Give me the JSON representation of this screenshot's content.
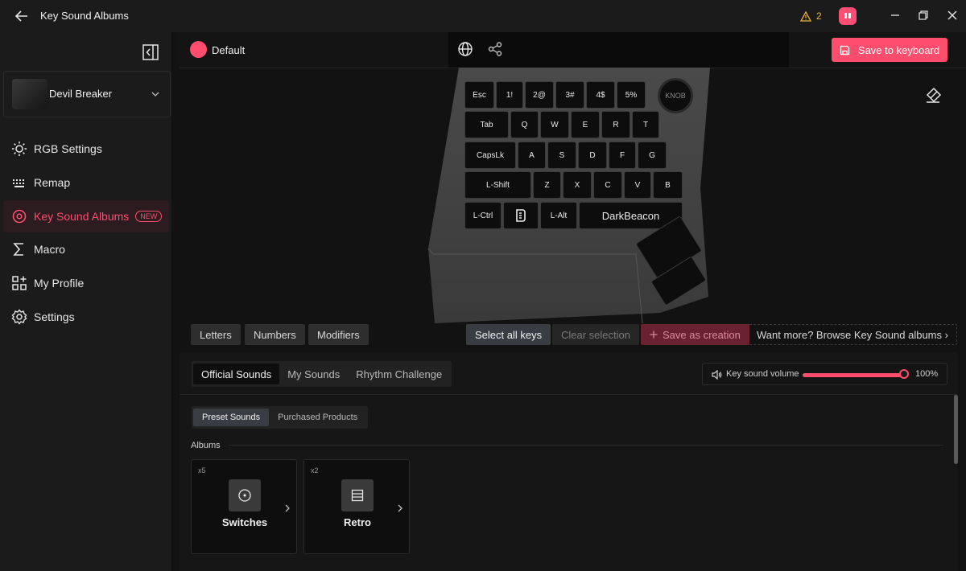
{
  "window": {
    "title": "Key Sound Albums",
    "warning_count": "2"
  },
  "sidebar": {
    "device_name": "Devil Breaker",
    "items": [
      {
        "label": "RGB Settings",
        "icon": "sun-icon"
      },
      {
        "label": "Remap",
        "icon": "keyboard-icon"
      },
      {
        "label": "Key Sound Albums",
        "icon": "target-icon",
        "badge": "NEW",
        "active": true
      },
      {
        "label": "Macro",
        "icon": "sigma-icon"
      },
      {
        "label": "My Profile",
        "icon": "grid-icon"
      },
      {
        "label": "Settings",
        "icon": "gear-icon"
      }
    ]
  },
  "header": {
    "profile_name": "Default",
    "save_button": "Save to keyboard"
  },
  "keyboard": {
    "knob_label": "KNOB",
    "rows": [
      [
        "Esc",
        "1!",
        "2@",
        "3#",
        "4$",
        "5%"
      ],
      [
        "Tab",
        "Q",
        "W",
        "E",
        "R",
        "T"
      ],
      [
        "CapsLk",
        "A",
        "S",
        "D",
        "F",
        "G"
      ],
      [
        "L-Shift",
        "Z",
        "X",
        "C",
        "V",
        "B"
      ],
      [
        "L-Ctrl",
        "",
        "L-Alt",
        "DarkBeacon"
      ]
    ]
  },
  "filters": {
    "letters": "Letters",
    "numbers": "Numbers",
    "modifiers": "Modifiers",
    "select_all": "Select all keys",
    "clear_selection": "Clear selection",
    "save_as_creation": "Save as creation",
    "want_more": "Want more? Browse Key Sound albums ›"
  },
  "panel": {
    "tabs": [
      "Official Sounds",
      "My Sounds",
      "Rhythm Challenge"
    ],
    "volume_label": "Key sound volume",
    "volume_value": "100%",
    "volume_level": 1.0,
    "subtabs": [
      "Preset Sounds",
      "Purchased Products"
    ],
    "albums_label": "Albums",
    "albums": [
      {
        "count": "x5",
        "name": "Switches",
        "icon": "record-icon"
      },
      {
        "count": "x2",
        "name": "Retro",
        "icon": "list-box-icon"
      }
    ]
  },
  "colors": {
    "accent": "#ff4d6d",
    "background": "#121212",
    "sidebar": "#1b1b1b"
  }
}
